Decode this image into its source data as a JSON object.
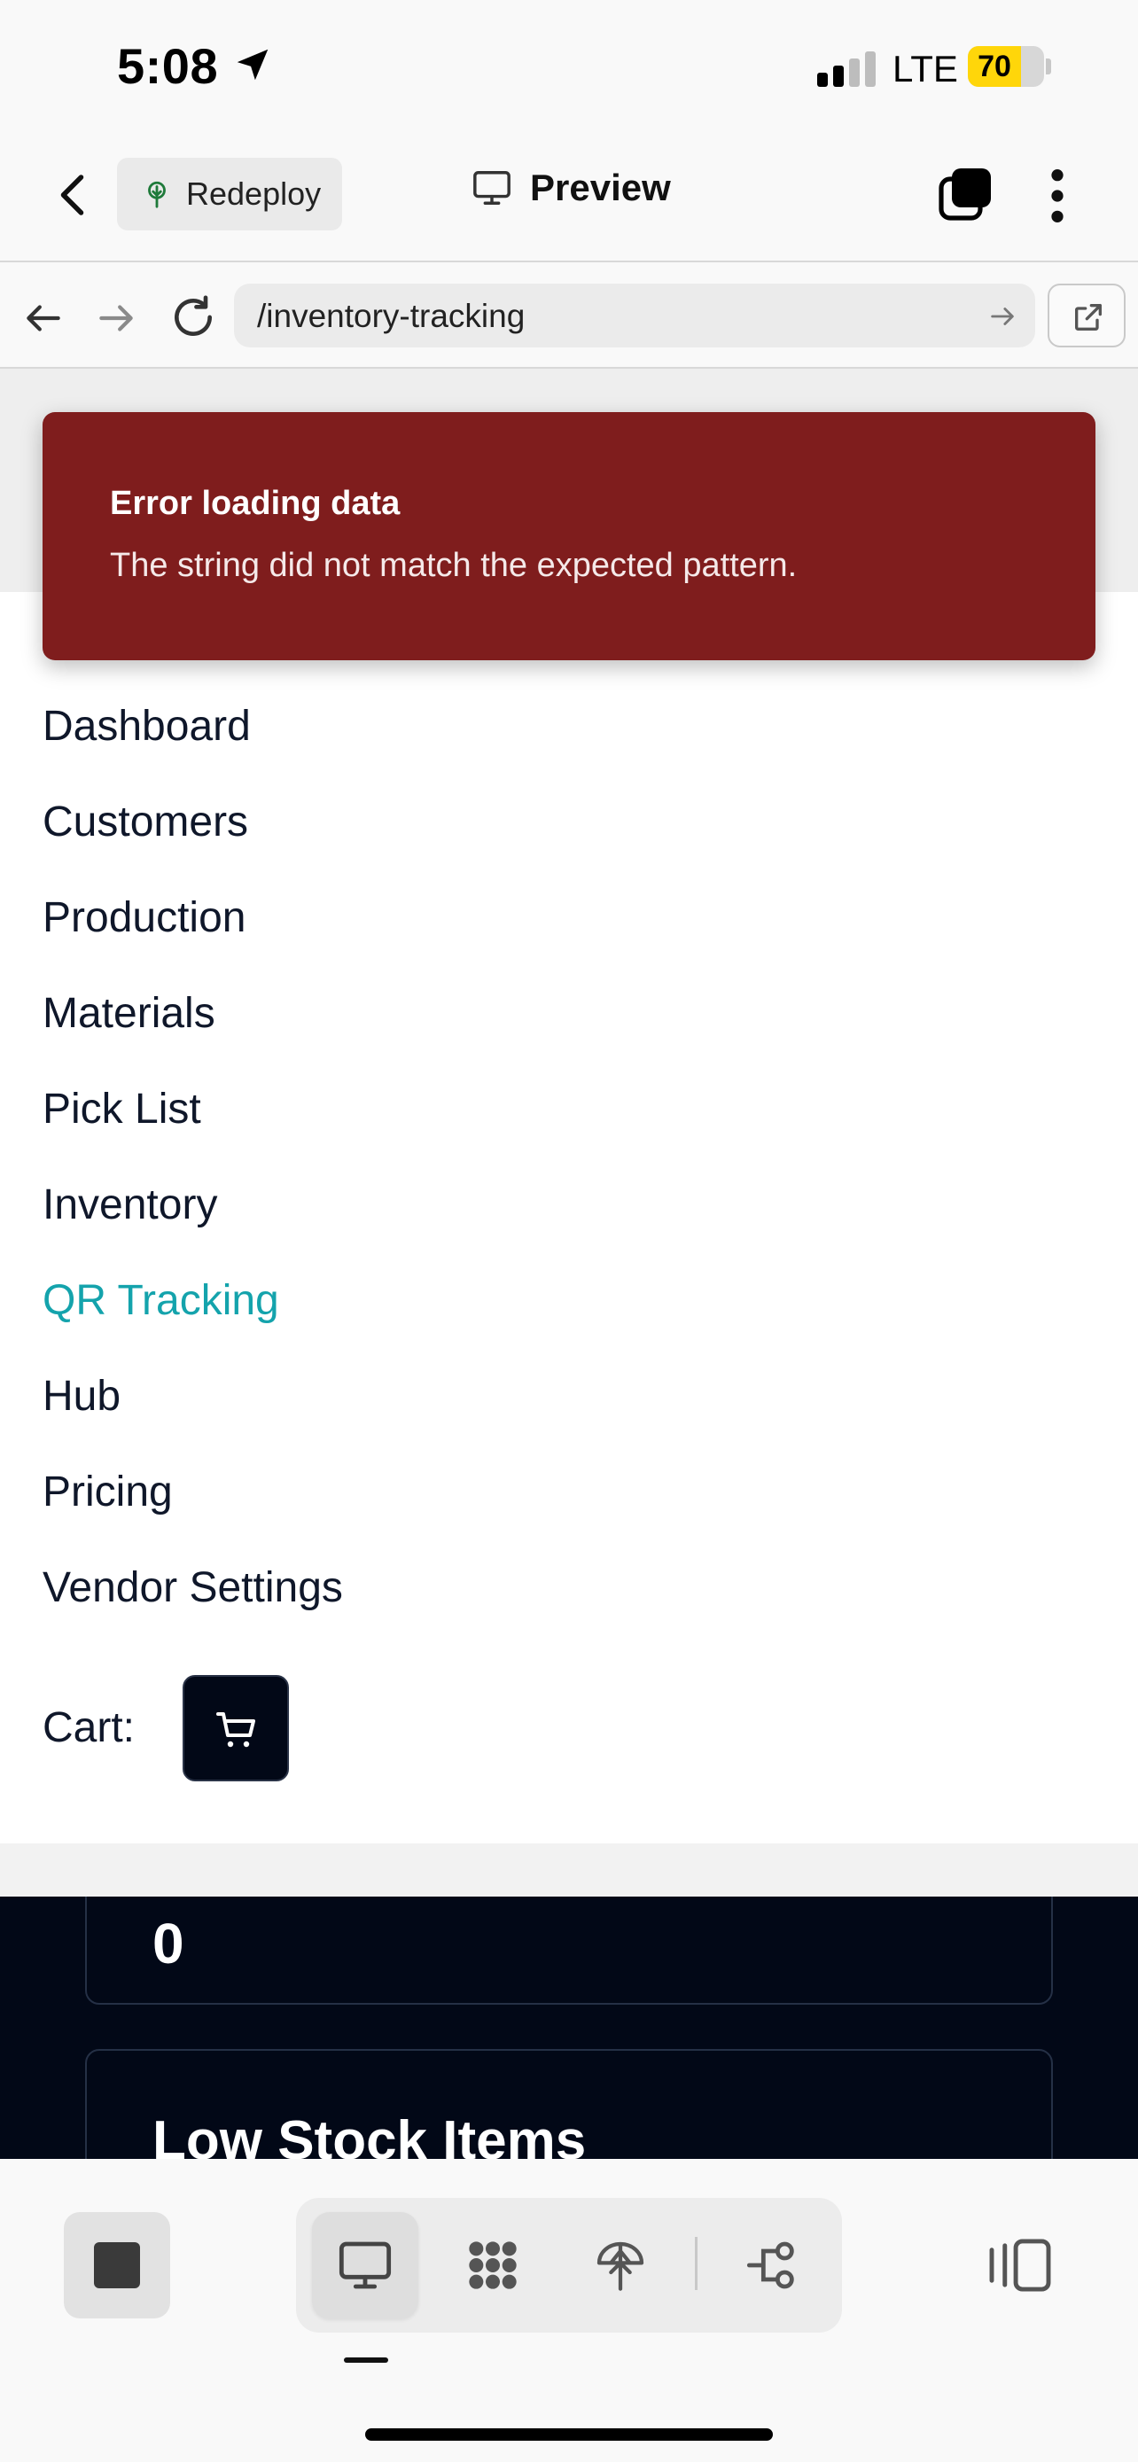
{
  "status_bar": {
    "time": "5:08",
    "network": "LTE",
    "battery_percent": "70",
    "battery_level": 0.7
  },
  "app_header": {
    "redeploy_label": "Redeploy",
    "preview_label": "Preview"
  },
  "browser": {
    "url": "/inventory-tracking"
  },
  "error_toast": {
    "title": "Error loading data",
    "message": "The string did not match the expected pattern."
  },
  "nav": {
    "items": [
      {
        "label": "Dashboard",
        "active": false
      },
      {
        "label": "Customers",
        "active": false
      },
      {
        "label": "Production",
        "active": false
      },
      {
        "label": "Materials",
        "active": false
      },
      {
        "label": "Pick List",
        "active": false
      },
      {
        "label": "Inventory",
        "active": false
      },
      {
        "label": "QR Tracking",
        "active": true
      },
      {
        "label": "Hub",
        "active": false
      },
      {
        "label": "Pricing",
        "active": false
      },
      {
        "label": "Vendor Settings",
        "active": false
      }
    ],
    "cart_label": "Cart:"
  },
  "dashboard": {
    "stat_value": "0",
    "low_stock_title": "Low Stock Items"
  },
  "colors": {
    "active_nav": "#14a3ac",
    "toast_bg": "#7f1d1d",
    "dark_bg": "#020817",
    "battery": "#ffd60a"
  },
  "icons": {
    "tabs": "tabs-icon",
    "more": "more-vertical-icon",
    "cart": "shopping-cart-icon"
  }
}
